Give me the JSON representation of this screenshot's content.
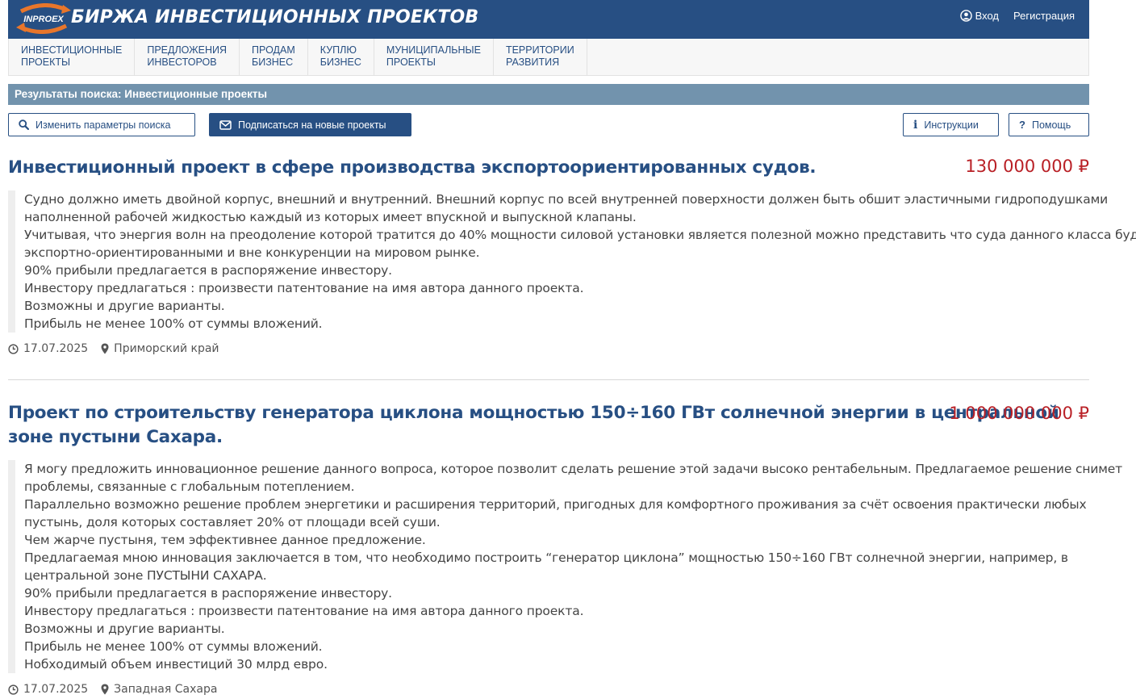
{
  "header": {
    "logo_text": "INPROEX",
    "title": "БИРЖА ИНВЕСТИЦИОННЫХ ПРОЕКТОВ",
    "login": "Вход",
    "register": "Регистрация"
  },
  "nav": [
    {
      "label": "ИНВЕСТИЦИОННЫЕ\nПРОЕКТЫ"
    },
    {
      "label": "ПРЕДЛОЖЕНИЯ\nИНВЕСТОРОВ"
    },
    {
      "label": "ПРОДАМ\nБИЗНЕС"
    },
    {
      "label": "КУПЛЮ\nБИЗНЕС"
    },
    {
      "label": "МУНИЦИПАЛЬНЫЕ\nПРОЕКТЫ"
    },
    {
      "label": "ТЕРРИТОРИИ\nРАЗВИТИЯ"
    }
  ],
  "results_title": "Результаты поиска: Инвестиционные проекты",
  "toolbar": {
    "change_search": "Изменить параметры поиска",
    "subscribe": "Подписаться на новые проекты",
    "instructions": "Инструкции",
    "help": "Помощь"
  },
  "listings": [
    {
      "title_lines": [
        "Инвестиционный проект в сфере производства экспортоориентированных судов."
      ],
      "price": "130 000 000 ₽",
      "desc_lines": [
        "Судно должно иметь двойной корпус, внешний и внутренний. Внешний корпус по всей внутренней поверхности должен быть обшит эластичными гидроподушками",
        "наполненной рабочей жидкостью каждый из которых имеет впускной и выпускной клапаны.",
        "Учитывая, что энергия волн на преодоление которой тратится до 40% мощности силовой установки является полезной можно представить что суда данного класса будут",
        "экспортно-ориентированными и вне конкуренции на мировом рынке.",
        "90% прибыли предлагается в распоряжение инвестору.",
        "Инвестору предлагаться : произвести патентование на имя автора данного проекта.",
        "Возможны и другие варианты.",
        "Прибыль не менее 100% от суммы вложений."
      ],
      "date": "17.07.2025",
      "location": "Приморский край"
    },
    {
      "title_lines": [
        "Проект по строительству генератора циклона мощностью 150÷160 ГВт солнечной энергии в центральной",
        "зоне пустыни Сахара."
      ],
      "price": "1 000 000 000 ₽",
      "desc_lines": [
        "Я могу предложить инновационное решение данного вопроса, которое позволит сделать решение этой задачи высоко рентабельным. Предлагаемое решение снимет",
        "проблемы, связанные с глобальным потеплением.",
        "Параллельно возможно решение проблем энергетики и расширения территорий, пригодных для комфортного проживания за счёт освоения практически любых",
        "пустынь, доля которых составляет 20% от площади всей суши.",
        "Чем жарче пустыня, тем эффективнее данное предложение.",
        "Предлагаемая мною инновация заключается в том, что необходимо построить “генератор циклона” мощностью 150÷160 ГВт солнечной энергии, например, в",
        "центральной зоне ПУСТЫНИ САХАРА.",
        "90% прибыли предлагается в распоряжение инвестору.",
        "Инвестору предлагаться : произвести патентование на имя автора данного проекта.",
        "Возможны и другие варианты.",
        "Прибыль не менее 100% от суммы вложений.",
        "Нобходимый объем инвестиций 30 млрд евро."
      ],
      "date": "17.07.2025",
      "location": "Западная Сахара"
    }
  ]
}
